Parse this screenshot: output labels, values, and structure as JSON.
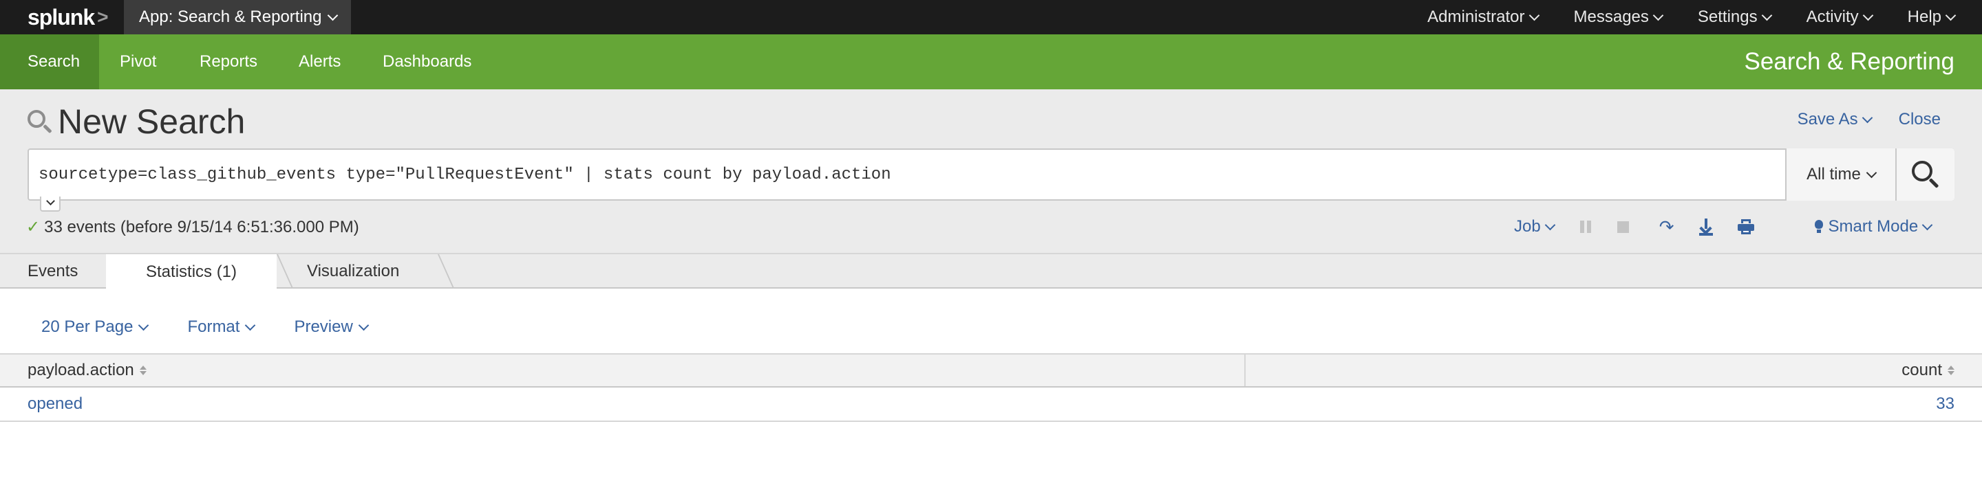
{
  "topbar": {
    "logo_text": "splunk",
    "logo_chevron": ">",
    "app_menu_label": "App: Search & Reporting",
    "menus": [
      {
        "label": "Administrator"
      },
      {
        "label": "Messages"
      },
      {
        "label": "Settings"
      },
      {
        "label": "Activity"
      },
      {
        "label": "Help"
      }
    ]
  },
  "appbar": {
    "tabs": [
      {
        "label": "Search",
        "active": true
      },
      {
        "label": "Pivot"
      },
      {
        "label": "Reports"
      },
      {
        "label": "Alerts"
      },
      {
        "label": "Dashboards"
      }
    ],
    "app_title": "Search & Reporting"
  },
  "search": {
    "page_title": "New Search",
    "save_as_label": "Save As",
    "close_label": "Close",
    "query": "sourcetype=class_github_events type=\"PullRequestEvent\" | stats count by payload.action",
    "time_range_label": "All time",
    "status_text": "33 events (before 9/15/14 6:51:36.000 PM)",
    "job_label": "Job",
    "mode_label": "Smart Mode"
  },
  "result_tabs": [
    {
      "label": "Events"
    },
    {
      "label": "Statistics (1)",
      "active": true
    },
    {
      "label": "Visualization"
    }
  ],
  "results": {
    "per_page_label": "20 Per Page",
    "format_label": "Format",
    "preview_label": "Preview",
    "columns": [
      "payload.action",
      "count"
    ],
    "rows": [
      {
        "action": "opened",
        "count": "33"
      }
    ]
  },
  "colors": {
    "accent_green": "#65a637",
    "link_blue": "#3863a0",
    "topbar_bg": "#1c1c1c"
  }
}
